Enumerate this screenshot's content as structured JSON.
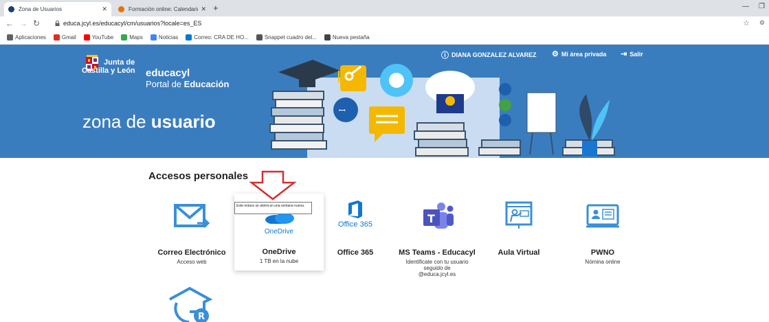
{
  "browser": {
    "tabs": [
      {
        "title": "Zona de Usuarios",
        "active": true
      },
      {
        "title": "Formación online: Calendario: Ve",
        "active": false
      }
    ],
    "new_tab_glyph": "+",
    "url": "educa.jcyl.es/educacyl/cm/usuarios?locale=es_ES",
    "bookmarks": [
      {
        "label": "Aplicaciones",
        "icon": "apps-grid-icon",
        "color": "#5f6368"
      },
      {
        "label": "Gmail",
        "icon": "gmail-icon",
        "color": "#d93025"
      },
      {
        "label": "YouTube",
        "icon": "youtube-icon",
        "color": "#ff0000"
      },
      {
        "label": "Maps",
        "icon": "maps-pin-icon",
        "color": "#34a853"
      },
      {
        "label": "Noticias",
        "icon": "google-icon",
        "color": "#4285f4"
      },
      {
        "label": "Correo: CRA DE HO...",
        "icon": "outlook-icon",
        "color": "#0078d4"
      },
      {
        "label": "Snappet cuadro del...",
        "icon": "snappet-icon",
        "color": "#555555"
      },
      {
        "label": "Nueva pestaña",
        "icon": "chrome-icon",
        "color": "#444444"
      }
    ]
  },
  "header": {
    "logo_line1": "Junta de",
    "logo_line2": "Castilla y León",
    "brand_title": "educacyl",
    "brand_sub_prefix": "Portal de",
    "brand_sub_bold": "Educación",
    "zona_prefix": "zona de",
    "zona_bold": "usuario",
    "user_name": "DIANA GONZALEZ ALVAREZ",
    "private_area": "Mi área privada",
    "logout": "Salir",
    "banner_color": "#3a7dbf"
  },
  "main": {
    "section_title": "Accesos personales",
    "tooltip": "Este enlace se abrirá en una ventana nueva.",
    "cards": [
      {
        "name": "Correo Electrónico",
        "sub": "Acceso web",
        "icon": "mail-forward-icon"
      },
      {
        "name": "OneDrive",
        "sub": "1 TB en la nube",
        "icon": "onedrive-icon",
        "logo_text": "OneDrive"
      },
      {
        "name": "Office 365",
        "sub": "",
        "icon": "office365-icon",
        "logo_text": "Office 365"
      },
      {
        "name": "MS Teams - Educacyl",
        "sub": "Identificate con tu usuario seguido de @educa.jcyl.es",
        "icon": "teams-icon"
      },
      {
        "name": "Aula Virtual",
        "sub": "",
        "icon": "virtual-classroom-icon"
      },
      {
        "name": "PWNO",
        "sub": "Nómina online",
        "icon": "payroll-icon"
      }
    ],
    "accent_color": "#3a8fd8",
    "arrow_color": "#d32f2f"
  }
}
